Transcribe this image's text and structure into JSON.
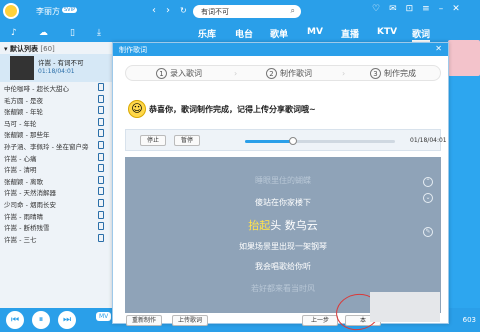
{
  "topbar": {
    "username": "李丽方",
    "vip": "SVIP",
    "search_value": "有词不可",
    "icons": [
      "skin-icon",
      "message-icon",
      "mail-icon",
      "menu-icon",
      "minimize-icon",
      "close-icon"
    ]
  },
  "nav": [
    "乐库",
    "电台",
    "歌单",
    "MV",
    "直播",
    "KTV",
    "歌词"
  ],
  "sidebar": {
    "list_title": "默认列表",
    "list_count": "[60]",
    "now_playing": {
      "title": "许嵩 - 有词不可",
      "time": "01:18/04:01"
    },
    "songs": [
      "中伦咖啡 - 超长大甜心",
      "毛方圆 - 是夜",
      "张靓颖 - 年轮",
      "马可 - 年轮",
      "张靓颖 - 那些年",
      "孙子涵、李佩玲 - 坐在窗户旁",
      "许嵩 - 心痛",
      "许嵩 - 清明",
      "张靓颖 - 离歌",
      "许嵩 - 天然消解器",
      "少司命 - 烟雨长安",
      "许嵩 - 雨晴晴",
      "许嵩 - 断桥残雪",
      "许嵩 - 三七"
    ]
  },
  "player": {
    "tag": "MV",
    "count": "603"
  },
  "dialog": {
    "title": "制作歌词",
    "steps": [
      {
        "num": "1",
        "label": "录入歌词"
      },
      {
        "num": "2",
        "label": "制作歌词"
      },
      {
        "num": "3",
        "label": "制作完成"
      }
    ],
    "congrats": "恭喜你，歌词制作完成，记得上传分享歌词哦~",
    "stop": "停止",
    "pause": "暂停",
    "time": "01/18/04:01",
    "progress": 0.32,
    "lyrics": [
      {
        "text": "睡眼里住的蝴蝶",
        "style": "dim"
      },
      {
        "text": "傻站在你家楼下",
        "style": "normal"
      },
      {
        "text": "头 数乌云",
        "prefix": "抬起",
        "style": "hl"
      },
      {
        "text": "如果场景里出现一架钢琴",
        "style": "normal"
      },
      {
        "text": "我会唱歌给你听",
        "style": "normal"
      },
      {
        "text": "若好都来看当时风",
        "style": "dim"
      }
    ],
    "buttons": {
      "remake": "重新制作",
      "upload": "上传歌词",
      "prev": "上一步",
      "finish": "本"
    }
  }
}
